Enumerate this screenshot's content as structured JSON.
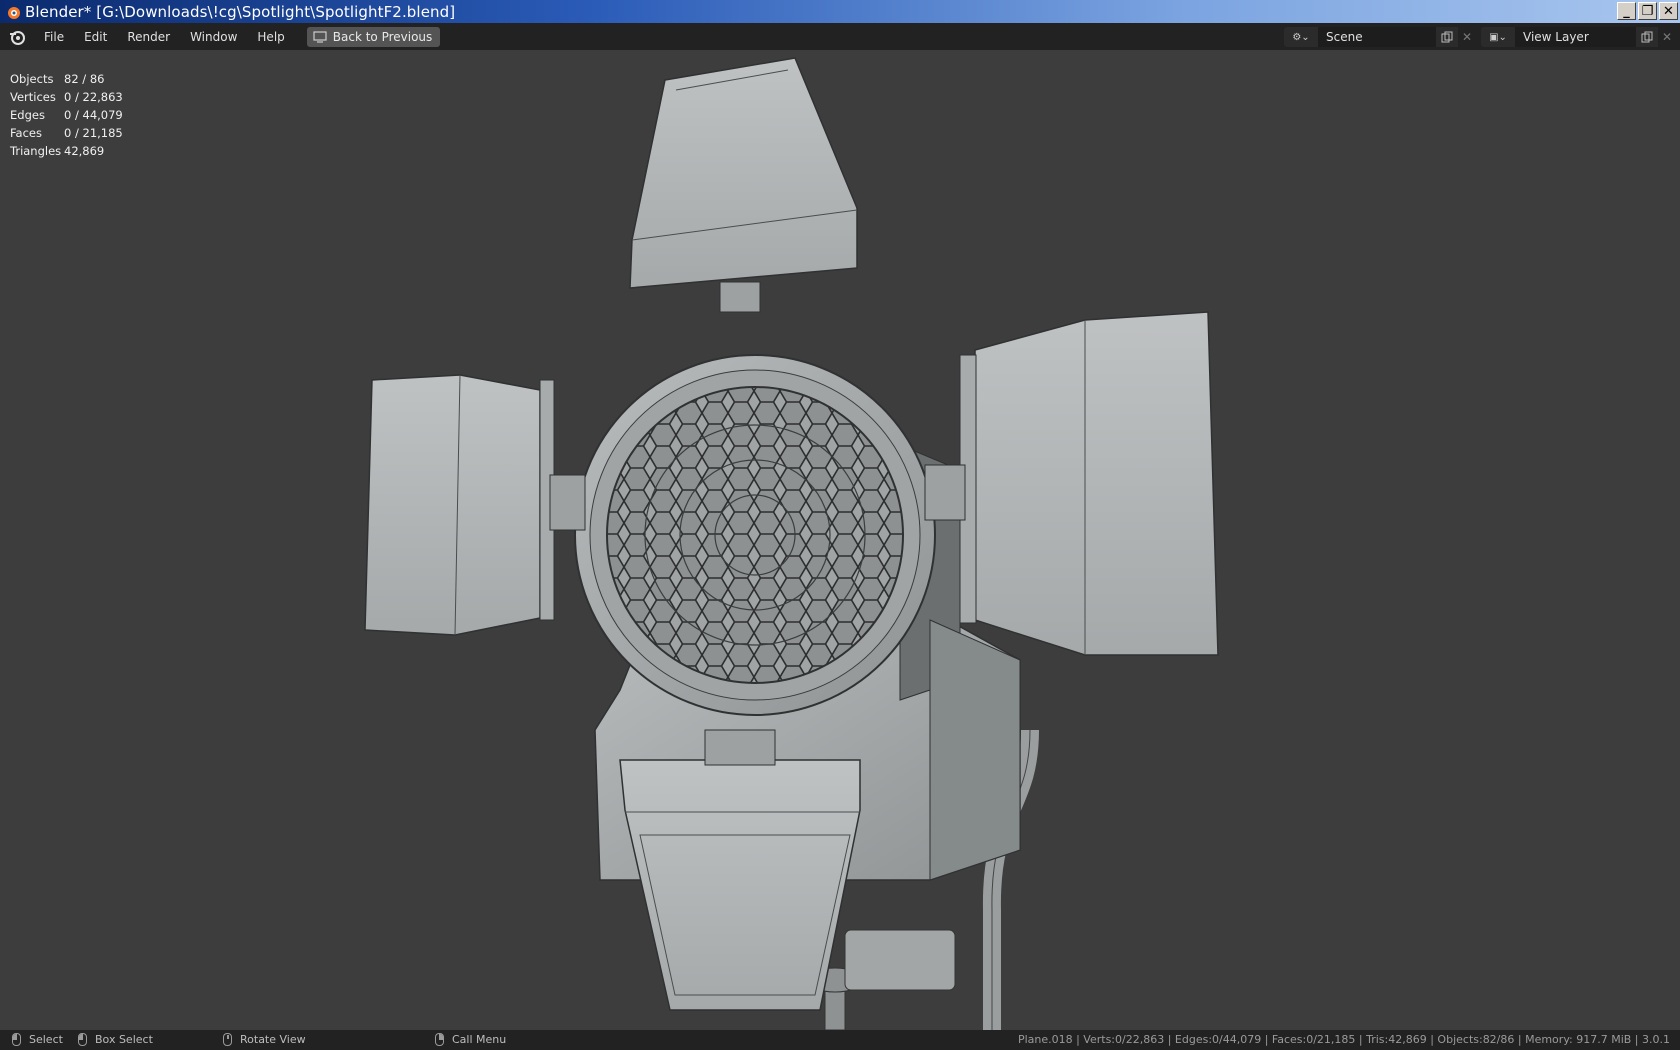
{
  "window": {
    "title": "Blender* [G:\\Downloads\\!cg\\Spotlight\\SpotlightF2.blend]",
    "minimize": "_",
    "restore": "❐",
    "close": "✕"
  },
  "menu": {
    "items": [
      "File",
      "Edit",
      "Render",
      "Window",
      "Help"
    ],
    "back_button": "Back to Previous"
  },
  "header": {
    "scene": "Scene",
    "view_layer": "View Layer"
  },
  "stats": [
    {
      "label": "Objects",
      "value": "82 / 86"
    },
    {
      "label": "Vertices",
      "value": "0 / 22,863"
    },
    {
      "label": "Edges",
      "value": "0 / 44,079"
    },
    {
      "label": "Faces",
      "value": "0 / 21,185"
    },
    {
      "label": "Triangles",
      "value": "42,869"
    }
  ],
  "statusbar": {
    "select": "Select",
    "box_select": "Box Select",
    "rotate_view": "Rotate View",
    "call_menu": "Call Menu",
    "info": "Plane.018 | Verts:0/22,863 | Edges:0/44,079 | Faces:0/21,185 | Tris:42,869 | Objects:82/86 | Memory: 917.7 MiB | 3.0.1"
  }
}
